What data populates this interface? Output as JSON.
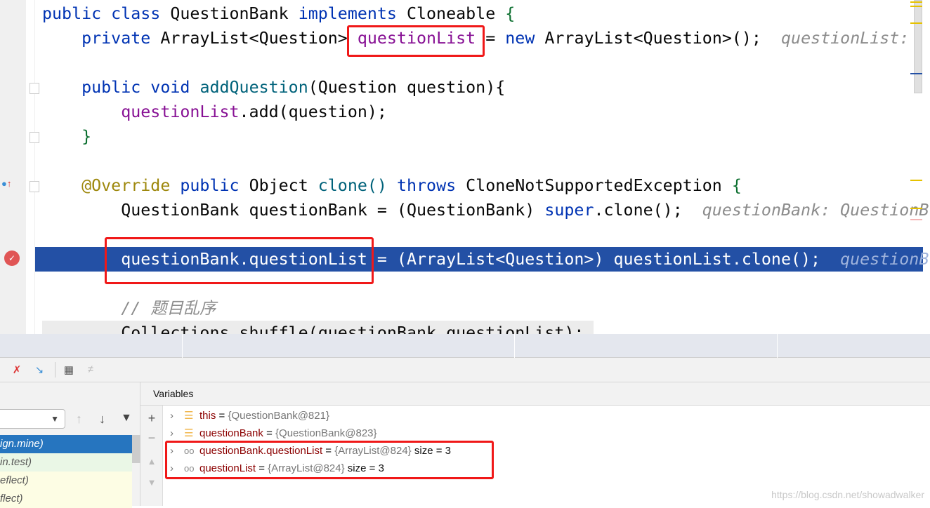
{
  "code": {
    "line0": [
      "public class",
      "QuestionBank",
      "implements",
      "Cloneable",
      "{"
    ],
    "line1": [
      "private",
      "ArrayList<Question>",
      "questionList",
      "=",
      "new",
      "ArrayList<Question>();",
      "questionList:"
    ],
    "line3": [
      "public void",
      "addQuestion",
      "(Question question){"
    ],
    "line4": [
      "questionList",
      ".add(question);"
    ],
    "line5": "}",
    "line7": [
      "@Override",
      "public",
      "Object",
      "clone()",
      "throws",
      "CloneNotSupportedException",
      "{"
    ],
    "line8": [
      "QuestionBank questionBank = (QuestionBank)",
      "super",
      ".clone();",
      "questionBank: QuestionB"
    ],
    "line10": [
      "questionBank.questionList = (ArrayList<Question>) questionList.clone();",
      "questionB"
    ],
    "line12": "// 题目乱序",
    "line13": "Collections.shuffle(questionBank.questionList);"
  },
  "frames": {
    "items": [
      "ign.mine)",
      "in.test)",
      "eflect)",
      "flect)"
    ]
  },
  "variables": {
    "header": "Variables",
    "rows": [
      {
        "name": "this",
        "eq": " = ",
        "value": "{QuestionBank@821}",
        "extra": "",
        "icon": "field-icon"
      },
      {
        "name": "questionBank",
        "eq": " = ",
        "value": "{QuestionBank@823}",
        "extra": "",
        "icon": "field-icon"
      },
      {
        "name": "questionBank.questionList",
        "eq": " = ",
        "value": "{ArrayList@824}",
        "extra": "size = 3",
        "icon": "watch-icon"
      },
      {
        "name": "questionList",
        "eq": " = ",
        "value": "{ArrayList@824}",
        "extra": "size = 3",
        "icon": "watch-icon"
      }
    ]
  },
  "watermark": "https://blog.csdn.net/showadwalker",
  "colors": {
    "highlight": "#2350a5",
    "annotation_box": "#f01818"
  }
}
